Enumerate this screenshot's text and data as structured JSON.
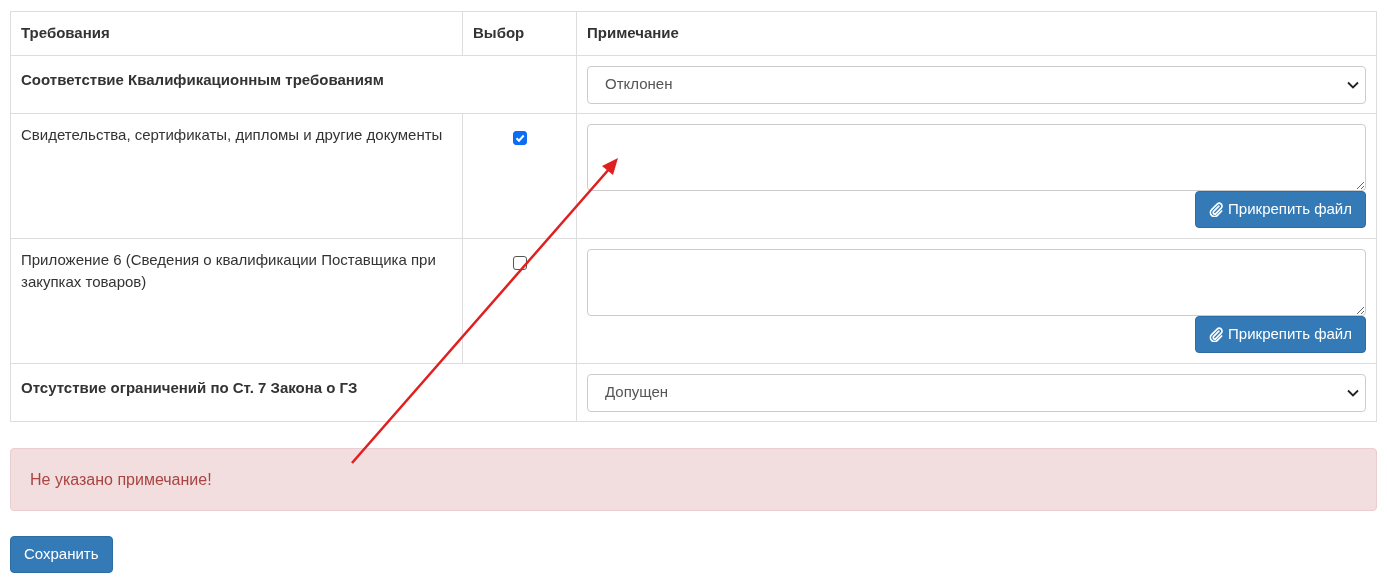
{
  "table": {
    "columns": [
      "Требования",
      "Выбор",
      "Примечание"
    ],
    "rows": [
      {
        "kind": "group",
        "label": "Соответствие Квалификационным требованиям",
        "value": "Отклонен"
      },
      {
        "kind": "item",
        "label": "Свидетельства, сертификаты, дипломы и другие документы",
        "checked": true,
        "button": "Прикрепить файл"
      },
      {
        "kind": "item",
        "label": "Приложение 6 (Сведения о квалификации Поставщика при закупках товаров)",
        "checked": false,
        "button": "Прикрепить файл"
      },
      {
        "kind": "group",
        "label": "Отсутствие ограничений по Ст. 7 Закона о ГЗ",
        "value": "Допущен"
      }
    ]
  },
  "alert": "Не указано примечание!",
  "save_button": "Сохранить"
}
